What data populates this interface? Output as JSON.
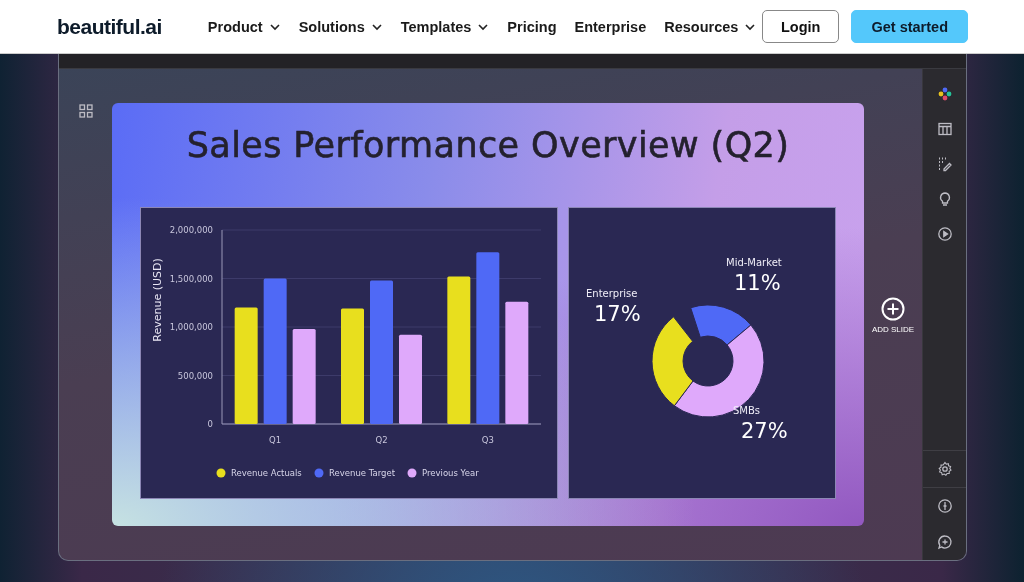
{
  "header": {
    "logo": "beautiful.ai",
    "nav": [
      {
        "label": "Product",
        "has_menu": true
      },
      {
        "label": "Solutions",
        "has_menu": true
      },
      {
        "label": "Templates",
        "has_menu": true
      },
      {
        "label": "Pricing",
        "has_menu": false
      },
      {
        "label": "Enterprise",
        "has_menu": false
      },
      {
        "label": "Resources",
        "has_menu": true
      }
    ],
    "buttons": [
      {
        "label": "Login",
        "kind": "outline"
      },
      {
        "label": "Get started",
        "kind": "primary"
      }
    ]
  },
  "editor": {
    "add_slide": "ADD SLIDE",
    "slide": {
      "title": "Sales Performance Overview (Q2)",
      "bar_chart": {
        "chart_data": {
          "type": "bar",
          "ylabel": "Revenue (USD)",
          "categories": [
            "Q1",
            "Q2",
            "Q3"
          ],
          "series": [
            {
              "name": "Revenue Actuals",
              "color": "#e8df1e",
              "values": [
                1200000,
                1190000,
                1520000
              ]
            },
            {
              "name": "Revenue Target",
              "color": "#4f69f6",
              "values": [
                1500000,
                1480000,
                1770000
              ]
            },
            {
              "name": "Previous Year",
              "color": "#dfa9fb",
              "values": [
                980000,
                920000,
                1260000
              ]
            }
          ],
          "ylim": [
            0,
            2000000
          ],
          "grid": true,
          "legend": true,
          "yticks": [
            {
              "value": 0,
              "label": "0"
            },
            {
              "value": 500000,
              "label": "500,000"
            },
            {
              "value": 1000000,
              "label": "1,000,000"
            },
            {
              "value": 1500000,
              "label": "1,500,000"
            },
            {
              "value": 2000000,
              "label": "2,000,000"
            }
          ]
        }
      },
      "donut_chart": {
        "chart_data": {
          "type": "donut",
          "categories": [
            "Mid-Market",
            "SMBs",
            "Enterprise"
          ],
          "values": [
            11,
            27,
            17
          ],
          "value_labels": [
            "11%",
            "27%",
            "17%"
          ]
        }
      }
    }
  }
}
